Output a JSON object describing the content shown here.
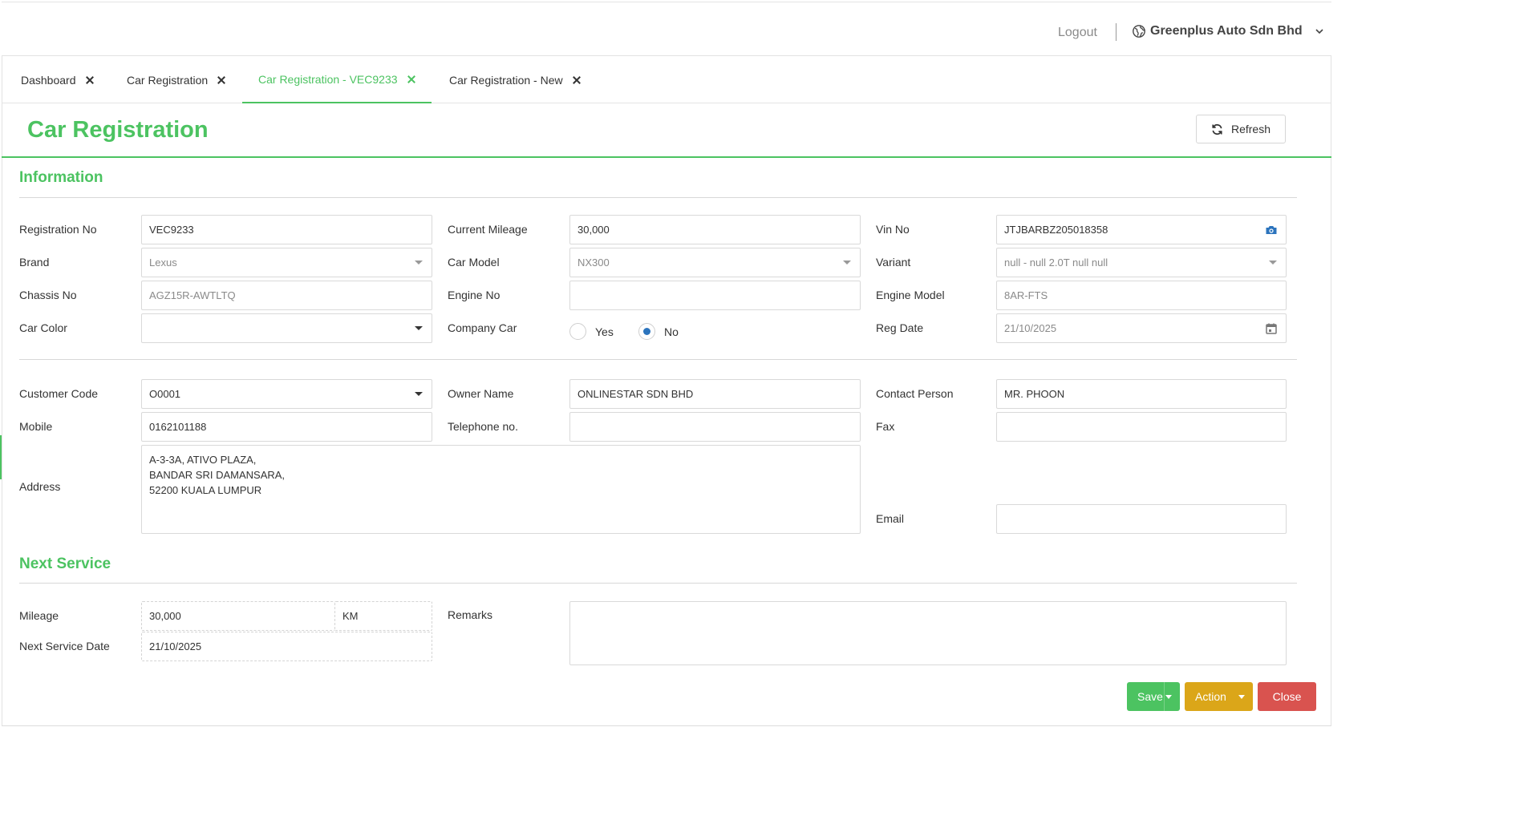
{
  "header": {
    "logout_label": "Logout",
    "company_name": "Greenplus Auto Sdn Bhd"
  },
  "tabs": [
    {
      "label": "Dashboard"
    },
    {
      "label": "Car Registration"
    },
    {
      "label": "Car Registration - VEC9233"
    },
    {
      "label": "Car Registration - New"
    }
  ],
  "page": {
    "title": "Car Registration",
    "refresh_label": "Refresh"
  },
  "information": {
    "title": "Information",
    "registration_no": {
      "label": "Registration No",
      "value": "VEC9233"
    },
    "current_mileage": {
      "label": "Current Mileage",
      "value": "30,000"
    },
    "vin_no": {
      "label": "Vin No",
      "value": "JTJBARBZ205018358"
    },
    "brand": {
      "label": "Brand",
      "value": "Lexus"
    },
    "car_model": {
      "label": "Car Model",
      "value": "NX300"
    },
    "variant": {
      "label": "Variant",
      "value": "null - null 2.0T null null"
    },
    "chassis_no": {
      "label": "Chassis No",
      "value": "AGZ15R-AWTLTQ"
    },
    "engine_no": {
      "label": "Engine No",
      "value": ""
    },
    "engine_model": {
      "label": "Engine Model",
      "value": "8AR-FTS"
    },
    "car_color": {
      "label": "Car Color",
      "value": ""
    },
    "company_car": {
      "label": "Company Car",
      "yes_label": "Yes",
      "no_label": "No",
      "selected": "No"
    },
    "reg_date": {
      "label": "Reg Date",
      "value": "21/10/2025"
    }
  },
  "customer": {
    "customer_code": {
      "label": "Customer Code",
      "value": "O0001"
    },
    "owner_name": {
      "label": "Owner Name",
      "value": "ONLINESTAR SDN BHD"
    },
    "contact_person": {
      "label": "Contact Person",
      "value": "MR. PHOON"
    },
    "mobile": {
      "label": "Mobile",
      "value": "0162101188"
    },
    "telephone": {
      "label": "Telephone no.",
      "value": ""
    },
    "fax": {
      "label": "Fax",
      "value": ""
    },
    "address": {
      "label": "Address",
      "value": "A-3-3A, ATIVO PLAZA,\nBANDAR SRI DAMANSARA,\n52200 KUALA LUMPUR"
    },
    "email": {
      "label": "Email",
      "value": ""
    }
  },
  "next_service": {
    "title": "Next Service",
    "mileage": {
      "label": "Mileage",
      "value": "30,000",
      "unit": "KM"
    },
    "next_service_date": {
      "label": "Next Service Date",
      "value": "21/10/2025"
    },
    "remarks": {
      "label": "Remarks",
      "value": ""
    }
  },
  "actions": {
    "save_label": "Save",
    "action_label": "Action",
    "close_label": "Close"
  },
  "colors": {
    "accent": "#4cc361",
    "action": "#dba619",
    "danger": "#d9534f",
    "radio": "#2c74bd"
  }
}
